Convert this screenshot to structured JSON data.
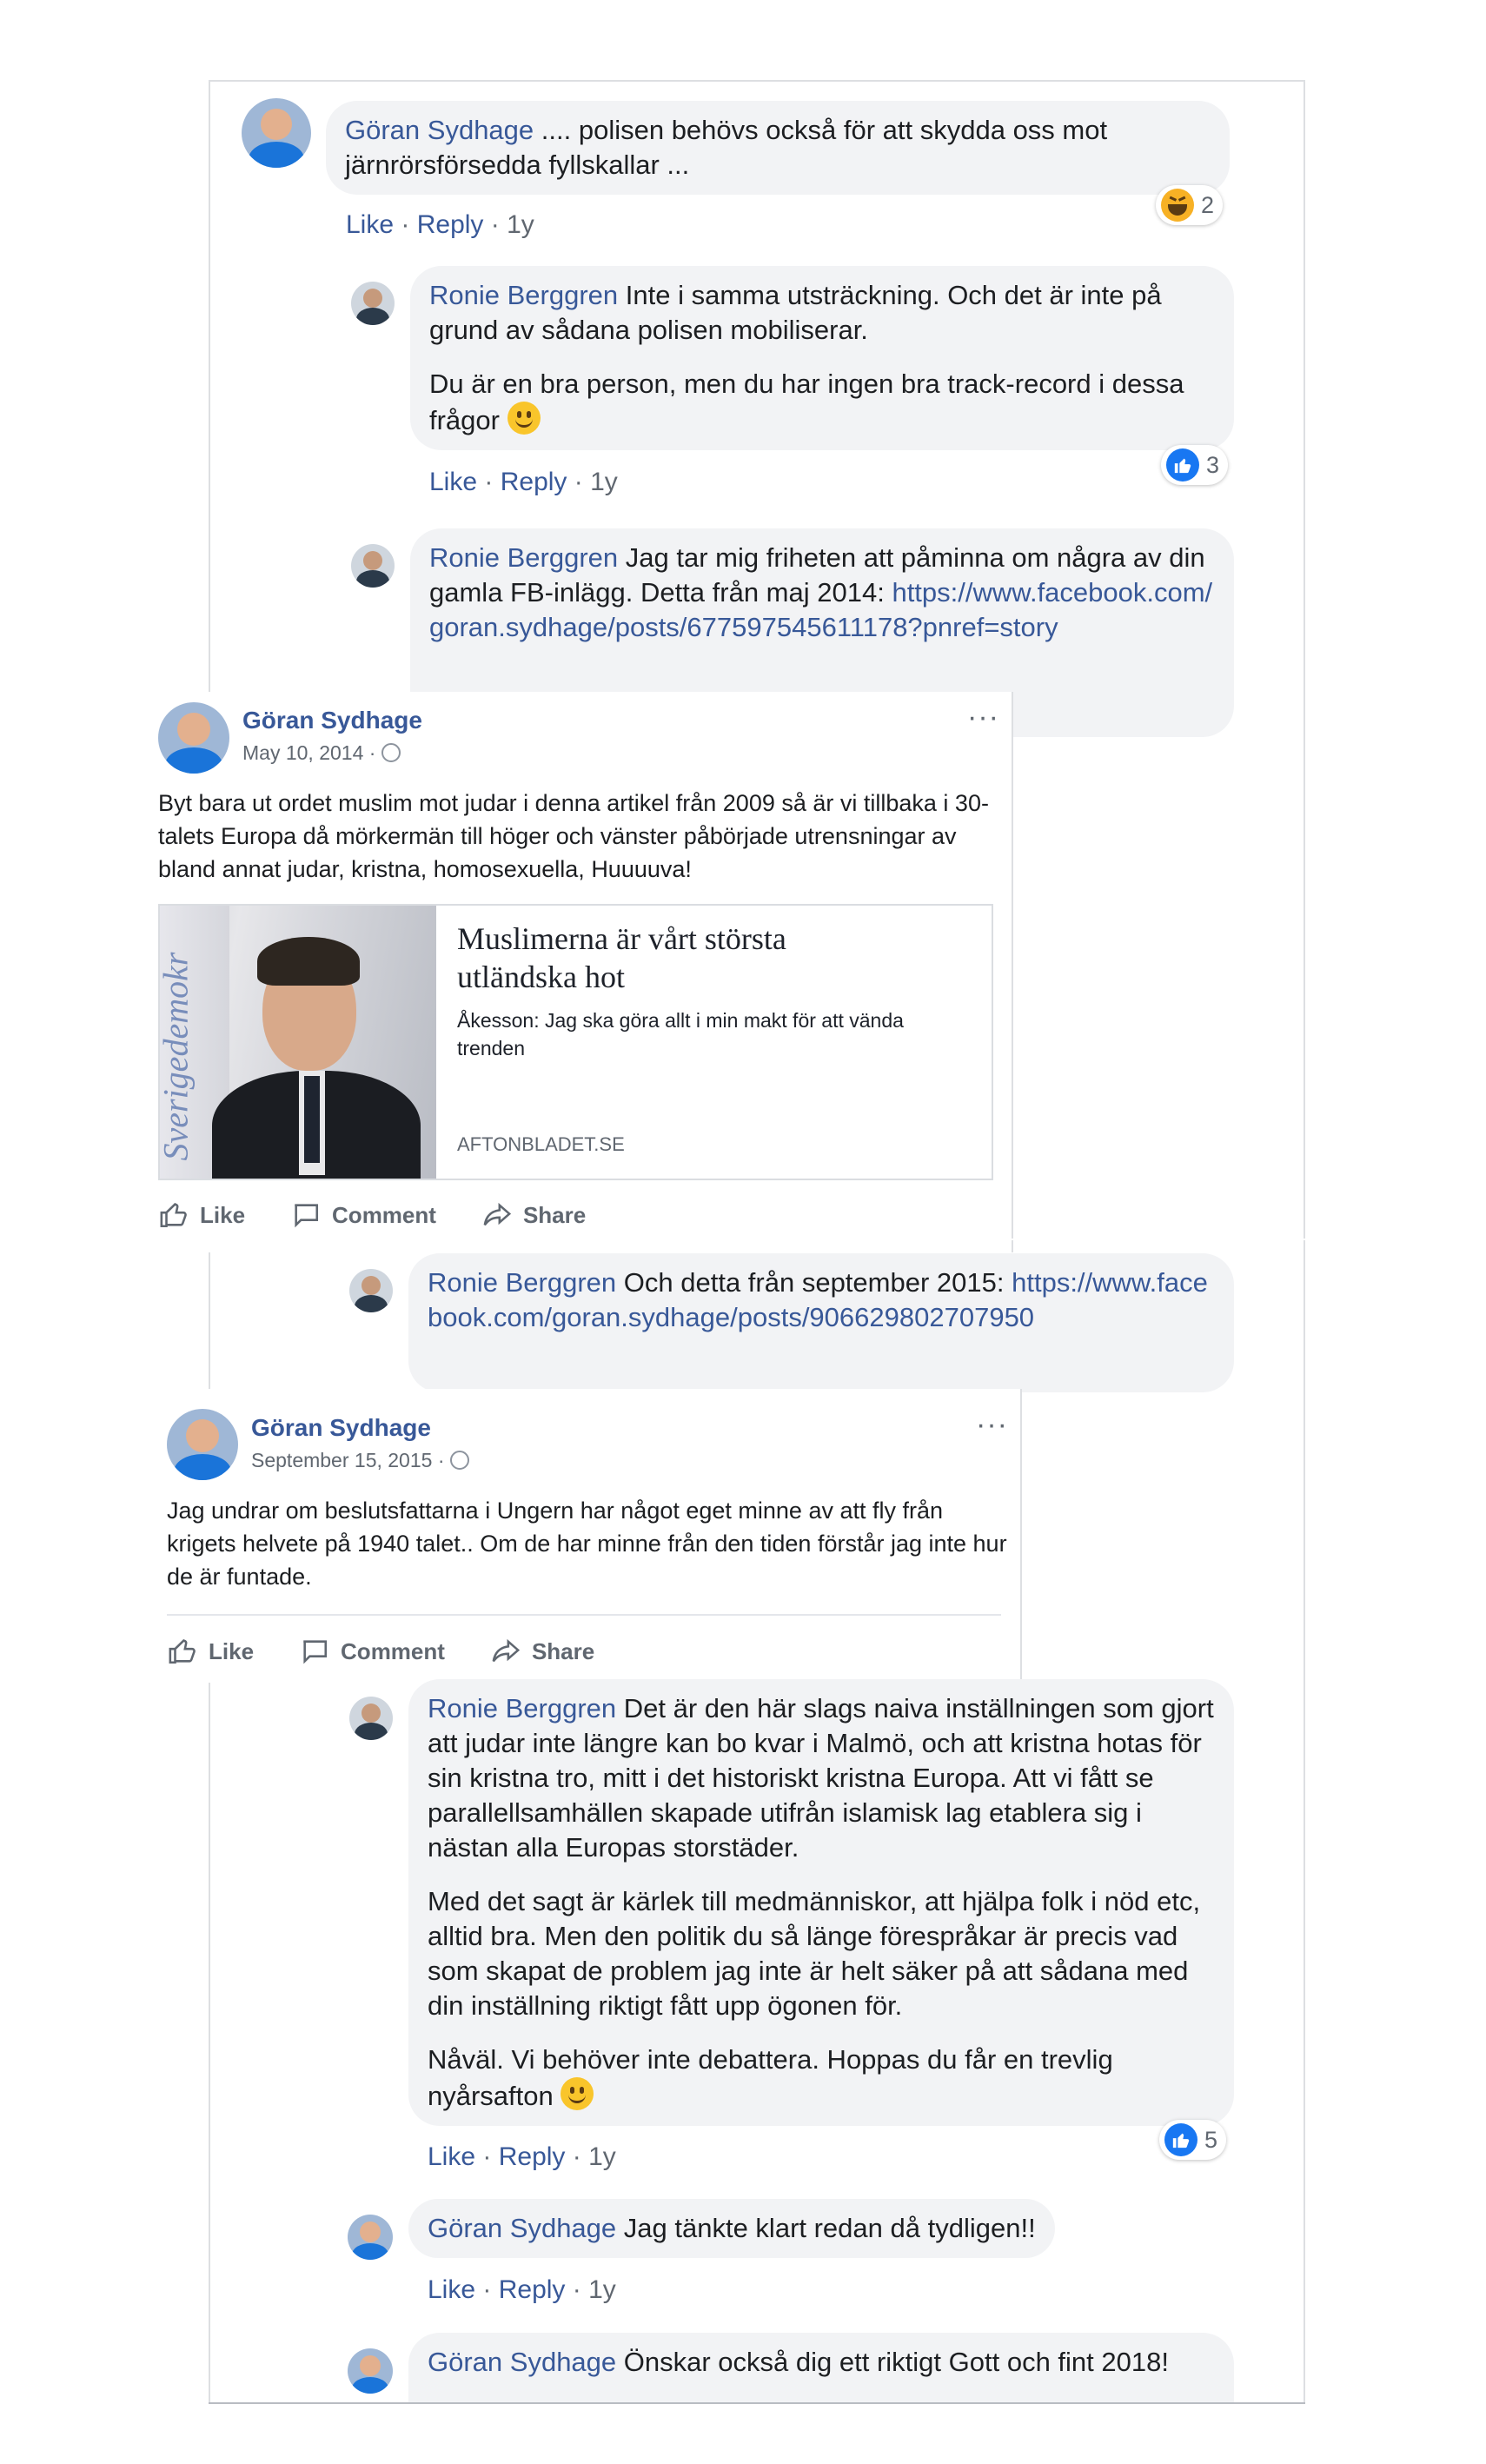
{
  "actions": {
    "like": "Like",
    "reply": "Reply",
    "sep": "·"
  },
  "comments": [
    {
      "author": "Göran Sydhage",
      "text": ".... polisen behövs också för att skydda oss mot järnrörsförsedda fyllskallar ...",
      "time": "1y",
      "reaction": {
        "type": "haha",
        "count": "2"
      }
    },
    {
      "author": "Ronie Berggren",
      "text": "Inte i samma utsträckning. Och det är inte på grund av sådana polisen mobiliserar.",
      "text2": "Du är en bra person, men du har ingen bra track-record i dessa frågor",
      "time": "1y",
      "reaction": {
        "type": "like",
        "count": "3"
      }
    },
    {
      "author": "Ronie Berggren",
      "text": "Jag tar mig friheten att påminna om några av din gamla FB-inlägg. Detta från maj 2014:",
      "link": "https://www.facebook.com/goran.sydhage/posts/677597545611178?pnref=story"
    },
    {
      "author": "Ronie Berggren",
      "text": "Och detta från september 2015:",
      "link": "https://www.facebook.com/goran.sydhage/posts/906629802707950"
    },
    {
      "author": "Ronie Berggren",
      "p1": "Det är den här slags naiva inställningen som gjort att judar inte längre kan bo kvar i Malmö, och att kristna hotas för sin kristna tro, mitt i det historiskt kristna Europa. Att vi fått se parallellsamhällen skapade utifrån islamisk lag etablera sig i nästan alla Europas storstäder.",
      "p2": "Med det sagt är kärlek till medmänniskor, att hjälpa folk i nöd etc, alltid bra. Men den politik du så länge förespråkar är precis vad som skapat de problem jag inte är helt säker på att sådana med din inställning riktigt fått upp ögonen för.",
      "p3": "Nåväl. Vi behöver inte debattera. Hoppas du får en trevlig nyårsafton",
      "time": "1y",
      "reaction": {
        "type": "like",
        "count": "5"
      }
    },
    {
      "author": "Göran Sydhage",
      "text": "Jag tänkte klart redan då tydligen!!",
      "time": "1y"
    },
    {
      "author": "Göran Sydhage",
      "text": "Önskar också dig ett riktigt Gott och fint 2018!"
    }
  ],
  "post1": {
    "author": "Göran Sydhage",
    "date": "May 10, 2014 ·",
    "text": "Byt bara ut ordet muslim mot judar i denna artikel från 2009 så är vi tillbaka i 30-talets Europa då mörkermän till höger och vänster påbörjade utrensningar av bland annat judar, kristna, homosexuella, Huuuuva!",
    "link_title": "Muslimerna är vårt största utländska hot",
    "link_desc": "Åkesson: Jag ska göra allt i min makt för att vända trenden",
    "link_domain": "AFTONBLADET.SE",
    "image_watermark": "Sverigedemokr",
    "more": "···"
  },
  "post2": {
    "author": "Göran Sydhage",
    "date": "September 15, 2015 ·",
    "text": "Jag undrar om beslutsfattarna i Ungern har något eget minne av att fly från krigets helvete på 1940 talet.. Om de har minne från den tiden förstår jag inte hur de är funtade.",
    "more": "···"
  },
  "post_actions": {
    "like": "Like",
    "comment": "Comment",
    "share": "Share"
  },
  "colors": {
    "link_blue": "#385898",
    "bubble_bg": "#f2f3f5",
    "like_blue": "#1877f2",
    "meta_gray": "#606770"
  }
}
